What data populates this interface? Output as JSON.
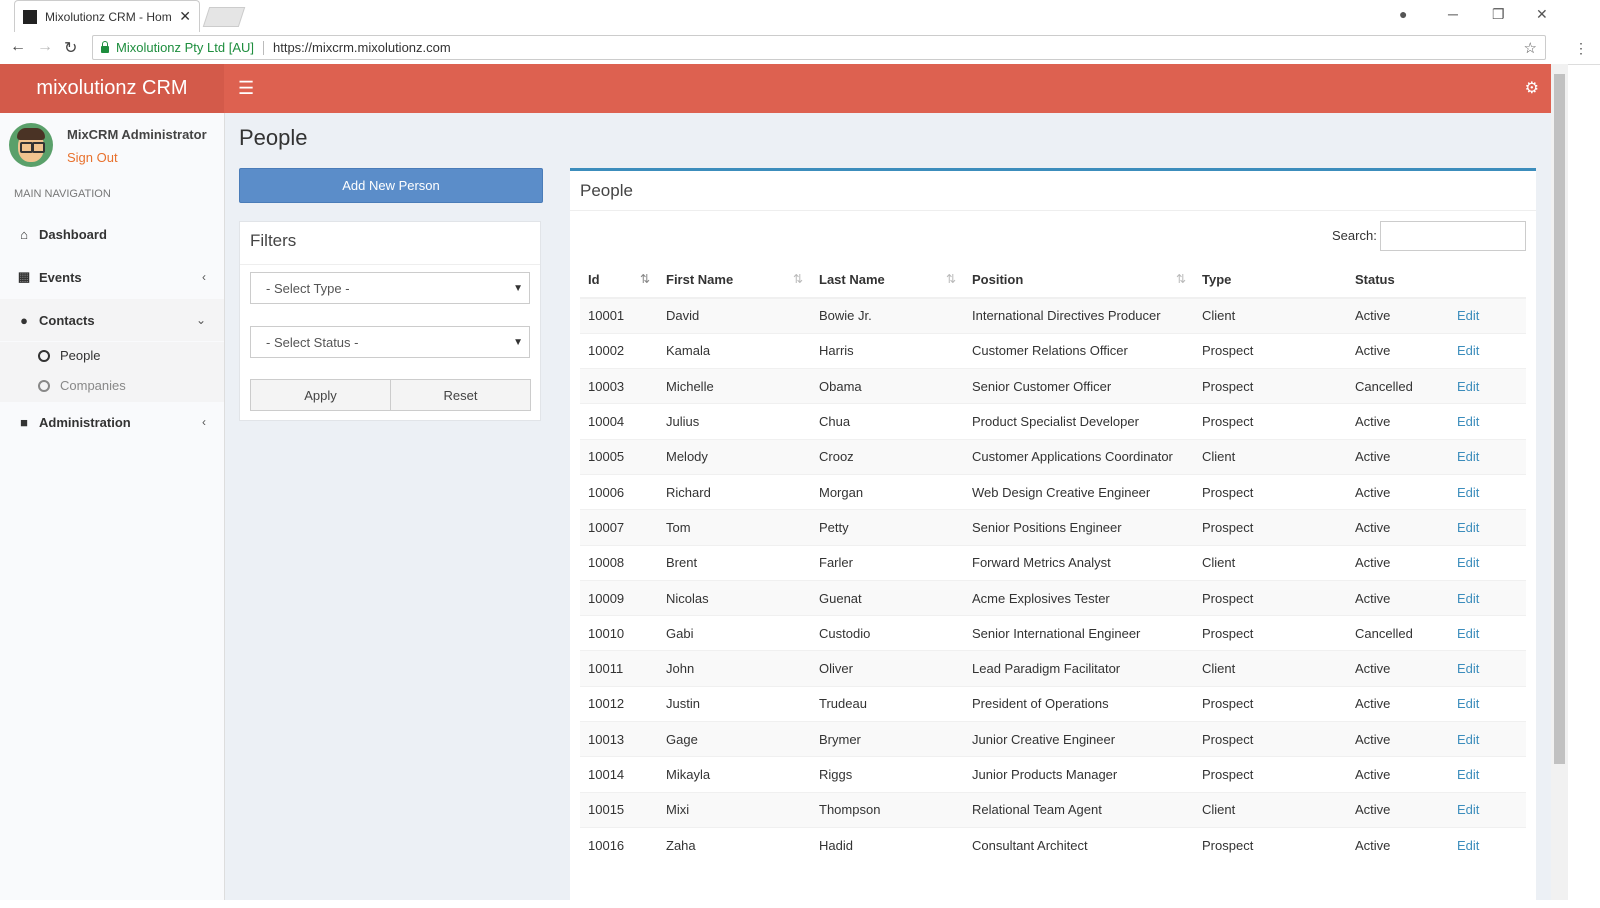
{
  "browser": {
    "tab_title": "Mixolutionz CRM - Hom",
    "tab_close": "✕",
    "secure_label": "Mixolutionz Pty Ltd [AU]",
    "url": "https://mixcrm.mixolutionz.com"
  },
  "app": {
    "logo": "mixolutionz CRM",
    "menu_icon": "hamburger-icon",
    "settings_icon": "gears-icon"
  },
  "user": {
    "name": "MixCRM Administrator",
    "signout": "Sign Out"
  },
  "sidebar": {
    "heading": "MAIN NAVIGATION",
    "items": [
      {
        "label": "Dashboard",
        "icon": "home-icon"
      },
      {
        "label": "Events",
        "icon": "calendar-icon"
      },
      {
        "label": "Contacts",
        "icon": "user-icon"
      },
      {
        "label": "Administration",
        "icon": "lock-icon"
      }
    ],
    "contacts_sub": [
      {
        "label": "People"
      },
      {
        "label": "Companies"
      }
    ]
  },
  "page": {
    "title": "People",
    "add_button": "Add New Person"
  },
  "filters": {
    "title": "Filters",
    "type_select": "- Select Type -",
    "status_select": "- Select Status -",
    "apply": "Apply",
    "reset": "Reset"
  },
  "table_panel": {
    "title": "People",
    "search_label": "Search:",
    "columns": [
      "Id",
      "First Name",
      "Last Name",
      "Position",
      "Type",
      "Status",
      ""
    ],
    "edit_label": "Edit",
    "rows": [
      [
        "10001",
        "David",
        "Bowie Jr.",
        "International Directives Producer",
        "Client",
        "Active"
      ],
      [
        "10002",
        "Kamala",
        "Harris",
        "Customer Relations Officer",
        "Prospect",
        "Active"
      ],
      [
        "10003",
        "Michelle",
        "Obama",
        "Senior Customer Officer",
        "Prospect",
        "Cancelled"
      ],
      [
        "10004",
        "Julius",
        "Chua",
        "Product Specialist Developer",
        "Prospect",
        "Active"
      ],
      [
        "10005",
        "Melody",
        "Crooz",
        "Customer Applications Coordinator",
        "Client",
        "Active"
      ],
      [
        "10006",
        "Richard",
        "Morgan",
        "Web Design Creative Engineer",
        "Prospect",
        "Active"
      ],
      [
        "10007",
        "Tom",
        "Petty",
        "Senior Positions Engineer",
        "Prospect",
        "Active"
      ],
      [
        "10008",
        "Brent",
        "Farler",
        "Forward Metrics Analyst",
        "Client",
        "Active"
      ],
      [
        "10009",
        "Nicolas",
        "Guenat",
        "Acme Explosives Tester",
        "Prospect",
        "Active"
      ],
      [
        "10010",
        "Gabi",
        "Custodio",
        "Senior International Engineer",
        "Prospect",
        "Cancelled"
      ],
      [
        "10011",
        "John",
        "Oliver",
        "Lead Paradigm Facilitator",
        "Client",
        "Active"
      ],
      [
        "10012",
        "Justin",
        "Trudeau",
        "President of Operations",
        "Prospect",
        "Active"
      ],
      [
        "10013",
        "Gage",
        "Brymer",
        "Junior Creative Engineer",
        "Prospect",
        "Active"
      ],
      [
        "10014",
        "Mikayla",
        "Riggs",
        "Junior Products Manager",
        "Prospect",
        "Active"
      ],
      [
        "10015",
        "Mixi",
        "Thompson",
        "Relational Team Agent",
        "Client",
        "Active"
      ],
      [
        "10016",
        "Zaha",
        "Hadid",
        "Consultant Architect",
        "Prospect",
        "Active"
      ]
    ]
  },
  "colors": {
    "header": "#dd6150",
    "logo_bg": "#d35a4a",
    "primary_button": "#5b8dc9",
    "link": "#3c8dbc",
    "signout": "#e8712d"
  }
}
